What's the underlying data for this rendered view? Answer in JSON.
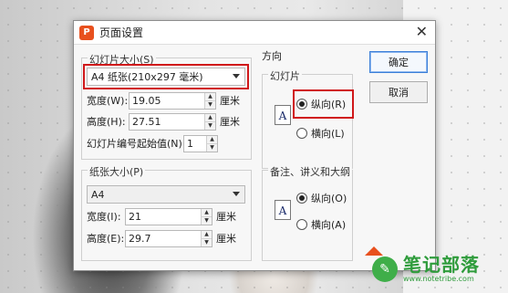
{
  "dialog": {
    "title": "页面设置",
    "app_icon": "P"
  },
  "slide_size": {
    "legend": "幻灯片大小(S)",
    "selected": "A4 纸张(210x297 毫米)",
    "width_label": "宽度(W):",
    "width_value": "19.05",
    "height_label": "高度(H):",
    "height_value": "27.51",
    "unit": "厘米",
    "start_label": "幻灯片编号起始值(N):",
    "start_value": "1"
  },
  "paper_size": {
    "legend": "纸张大小(P)",
    "selected": "A4",
    "width_label": "宽度(I):",
    "width_value": "21",
    "height_label": "高度(E):",
    "height_value": "29.7",
    "unit": "厘米"
  },
  "orientation": {
    "legend": "方向",
    "slides": {
      "legend": "幻灯片",
      "portrait": "纵向(R)",
      "landscape": "横向(L)"
    },
    "notes": {
      "legend": "备注、讲义和大纲",
      "portrait": "纵向(O)",
      "landscape": "横向(A)"
    },
    "doc_glyph": "A"
  },
  "buttons": {
    "ok": "确定",
    "cancel": "取消"
  },
  "watermark": {
    "main": "笔记部落",
    "sub": "www.notetribe.com"
  },
  "colors": {
    "highlight": "#d0181a",
    "app_icon": "#e8501e",
    "watermark": "#2f9c3c"
  }
}
